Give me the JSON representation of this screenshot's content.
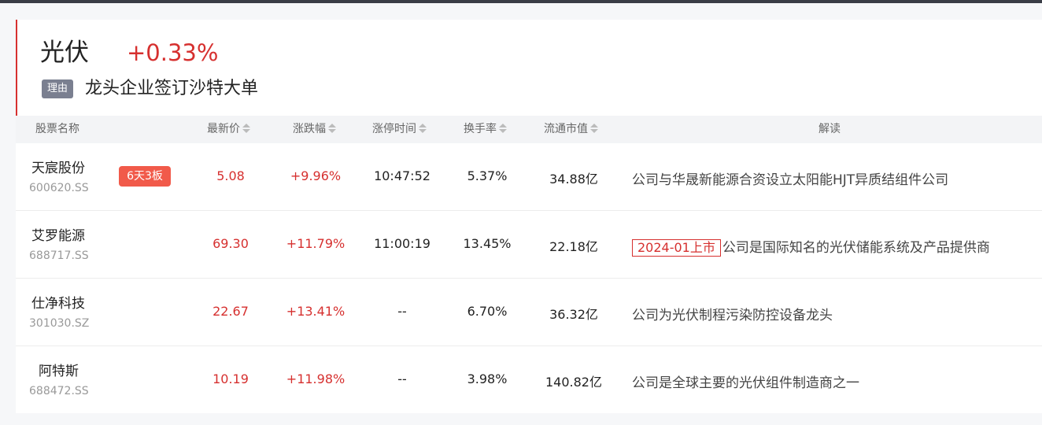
{
  "sector": {
    "name": "光伏",
    "change": "+0.33%",
    "reason_label": "理由",
    "reason": "龙头企业签订沙特大单"
  },
  "table": {
    "headers": {
      "name": "股票名称",
      "price": "最新价",
      "change": "涨跌幅",
      "limit_time": "涨停时间",
      "turnover": "换手率",
      "mcap": "流通市值",
      "reading": "解读"
    },
    "rows": [
      {
        "name": "天宸股份",
        "code": "600620.SS",
        "badge": "6天3板",
        "price": "5.08",
        "change": "+9.96%",
        "limit_time": "10:47:52",
        "turnover": "5.37%",
        "mcap": "34.88亿",
        "tag": "",
        "reading": "公司与华晟新能源合资设立太阳能HJT异质结组件公司"
      },
      {
        "name": "艾罗能源",
        "code": "688717.SS",
        "badge": "",
        "price": "69.30",
        "change": "+11.79%",
        "limit_time": "11:00:19",
        "turnover": "13.45%",
        "mcap": "22.18亿",
        "tag": "2024-01上市",
        "reading": "公司是国际知名的光伏储能系统及产品提供商"
      },
      {
        "name": "仕净科技",
        "code": "301030.SZ",
        "badge": "",
        "price": "22.67",
        "change": "+13.41%",
        "limit_time": "--",
        "turnover": "6.70%",
        "mcap": "36.32亿",
        "tag": "",
        "reading": "公司为光伏制程污染防控设备龙头"
      },
      {
        "name": "阿特斯",
        "code": "688472.SS",
        "badge": "",
        "price": "10.19",
        "change": "+11.98%",
        "limit_time": "--",
        "turnover": "3.98%",
        "mcap": "140.82亿",
        "tag": "",
        "reading": "公司是全球主要的光伏组件制造商之一"
      }
    ]
  },
  "colors": {
    "up": "#d6302f",
    "badge_bg": "#f15a4a",
    "reason_badge_bg": "#7a7f90",
    "header_bg": "#f3f4f6"
  },
  "icons": {
    "sort": "sort-up-down-icon"
  }
}
